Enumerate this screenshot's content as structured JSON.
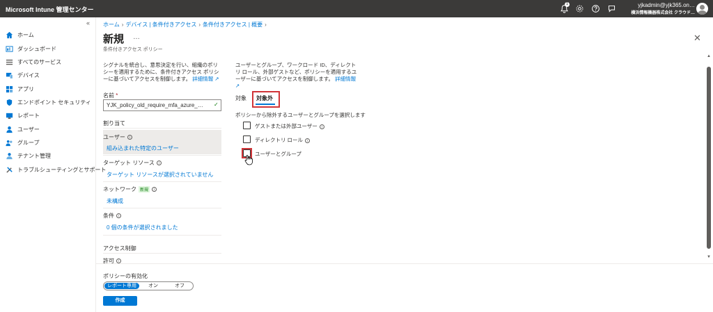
{
  "app": {
    "title": "Microsoft Intune 管理センター"
  },
  "topbar": {
    "notification_count": "1",
    "account_name": "yjkadmin@yjk365.on…",
    "account_org": "横浜情報機器株式会社 クラウド…",
    "icons": [
      "bell-icon",
      "gear-icon",
      "help-icon",
      "feedback-icon",
      "avatar"
    ]
  },
  "sidebar": {
    "collapse": "«",
    "items": [
      {
        "label": "ホーム",
        "icon": "home-icon"
      },
      {
        "label": "ダッシュボード",
        "icon": "dashboard-icon"
      },
      {
        "label": "すべてのサービス",
        "icon": "list-icon"
      },
      {
        "label": "デバイス",
        "icon": "devices-icon"
      },
      {
        "label": "アプリ",
        "icon": "apps-icon"
      },
      {
        "label": "エンドポイント セキュリティ",
        "icon": "shield-icon"
      },
      {
        "label": "レポート",
        "icon": "reports-icon"
      },
      {
        "label": "ユーザー",
        "icon": "user-icon"
      },
      {
        "label": "グループ",
        "icon": "group-icon"
      },
      {
        "label": "テナント管理",
        "icon": "tenant-icon"
      },
      {
        "label": "トラブルシューティングとサポート",
        "icon": "tools-icon"
      }
    ]
  },
  "breadcrumb": [
    "ホーム",
    "デバイス | 条件付きアクセス",
    "条件付きアクセス | 概要"
  ],
  "page": {
    "title": "新規",
    "more": "…",
    "subtitle": "条件付きアクセス ポリシー",
    "close": "✕"
  },
  "left": {
    "description": "シグナルを統合し、意思決定を行い、組織のポリシーを適用するために、条件付きアクセス ポリシーに基づいてアクセスを制御します。",
    "learn_more": "詳細情報",
    "name_label": "名前",
    "name_required": "*",
    "name_value": "YJK_policy_old_require_mfa_azure_…",
    "assignments_heading": "割り当て",
    "users_label": "ユーザー",
    "users_value": "組み込まれた特定のユーザー",
    "target_label": "ターゲット リソース",
    "target_value": "ターゲット リソースが選択されていません",
    "network_label": "ネットワーク",
    "network_badge": "新規",
    "network_value": "未構成",
    "conditions_label": "条件",
    "conditions_value": "0 個の条件が選択されました",
    "access_heading": "アクセス制御",
    "grant_label": "許可"
  },
  "right": {
    "description": "ユーザーとグループ、ワークロード ID、ディレクトリ ロール、外部ゲストなど、ポリシーを適用するユーザーに基づいてアクセスを制御します。",
    "learn_more": "詳細情報",
    "tabs": [
      "対象",
      "対象外"
    ],
    "instruction": "ポリシーから除外するユーザーとグループを選択します",
    "checkboxes": [
      {
        "label": "ゲストまたは外部ユーザー",
        "checked": false
      },
      {
        "label": "ディレクトリ ロール",
        "checked": false
      },
      {
        "label": "ユーザーとグループ",
        "checked": false
      }
    ]
  },
  "footer": {
    "enable_label": "ポリシーの有効化",
    "options": [
      "レポート専用",
      "オン",
      "オフ"
    ],
    "selected": "レポート専用",
    "create_label": "作成"
  },
  "colors": {
    "accent": "#0078d4",
    "topbar": "#3b3a39",
    "highlight": "#d13438",
    "required": "#a4262c"
  }
}
